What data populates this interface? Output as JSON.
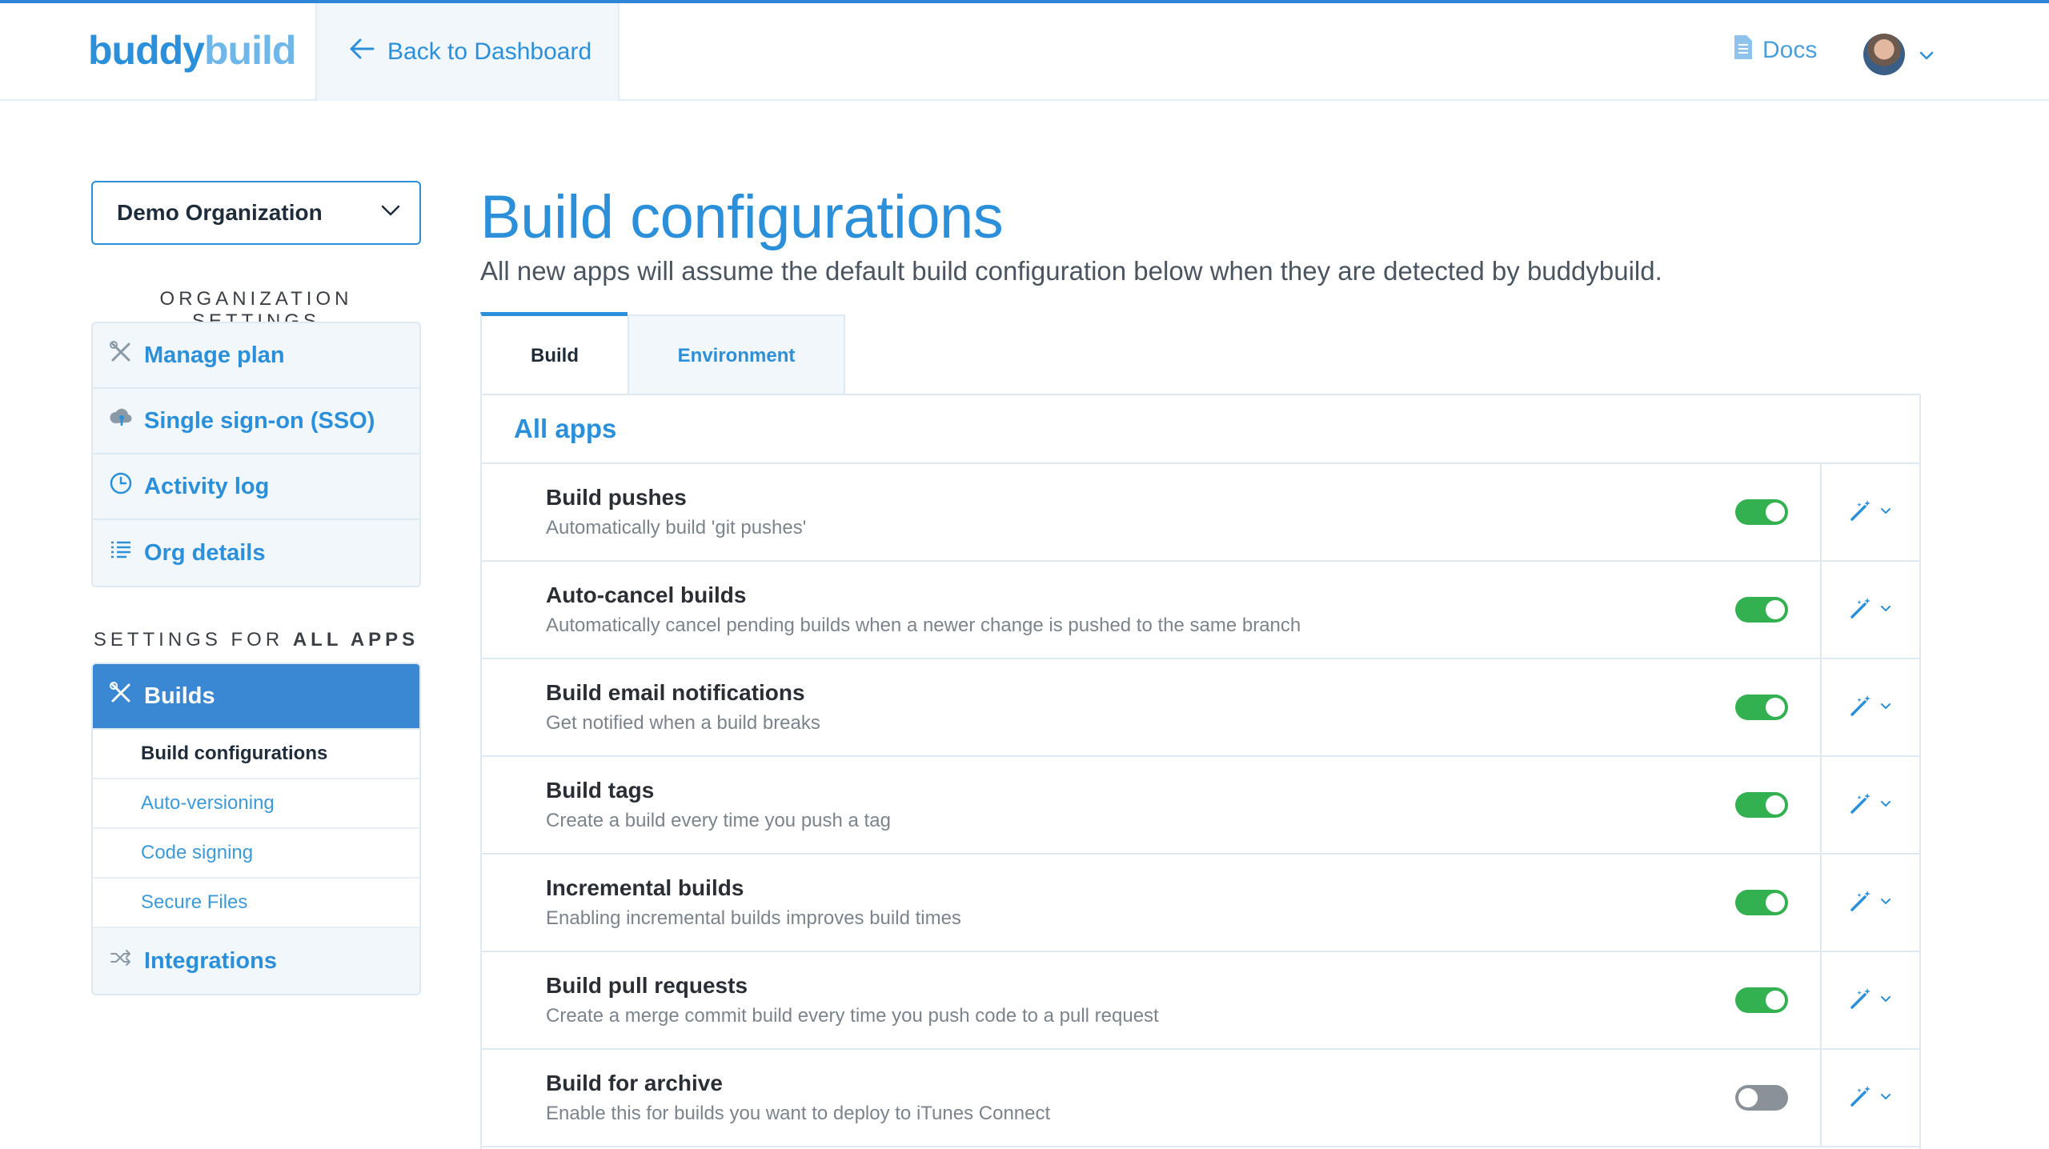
{
  "header": {
    "logo_left": "buddy",
    "logo_right": "build",
    "back_label": "Back to Dashboard",
    "docs_label": "Docs"
  },
  "sidebar": {
    "org_select": "Demo Organization",
    "org_settings_heading": "ORGANIZATION SETTINGS",
    "org_items": [
      {
        "label": "Manage plan",
        "icon": "tools-icon"
      },
      {
        "label": "Single sign-on (SSO)",
        "icon": "sso-icon"
      },
      {
        "label": "Activity log",
        "icon": "clock-icon"
      },
      {
        "label": "Org details",
        "icon": "list-icon"
      }
    ],
    "apps_heading_prefix": "SETTINGS FOR",
    "apps_heading_bold": "ALL APPS",
    "builds_label": "Builds",
    "build_subitems": [
      "Build configurations",
      "Auto-versioning",
      "Code signing",
      "Secure Files"
    ],
    "integrations_label": "Integrations"
  },
  "main": {
    "title": "Build configurations",
    "subtitle": "All new apps will assume the default build configuration below when they are detected by buddybuild.",
    "tabs": [
      "Build",
      "Environment"
    ],
    "panel_heading": "All apps",
    "configs": [
      {
        "title": "Build pushes",
        "desc": "Automatically build 'git pushes'",
        "enabled": true
      },
      {
        "title": "Auto-cancel builds",
        "desc": "Automatically cancel pending builds when a newer change is pushed to the same branch",
        "enabled": true
      },
      {
        "title": "Build email notifications",
        "desc": "Get notified when a build breaks",
        "enabled": true
      },
      {
        "title": "Build tags",
        "desc": "Create a build every time you push a tag",
        "enabled": true
      },
      {
        "title": "Incremental builds",
        "desc": "Enabling incremental builds improves build times",
        "enabled": true
      },
      {
        "title": "Build pull requests",
        "desc": "Create a merge commit build every time you push code to a pull request",
        "enabled": true
      },
      {
        "title": "Build for archive",
        "desc": "Enable this for builds you want to deploy to iTunes Connect",
        "enabled": false
      }
    ]
  },
  "colors": {
    "accent": "#2b90d9",
    "active_nav": "#3a87d3",
    "toggle_on": "#33b04f",
    "toggle_off": "#8a9199"
  }
}
